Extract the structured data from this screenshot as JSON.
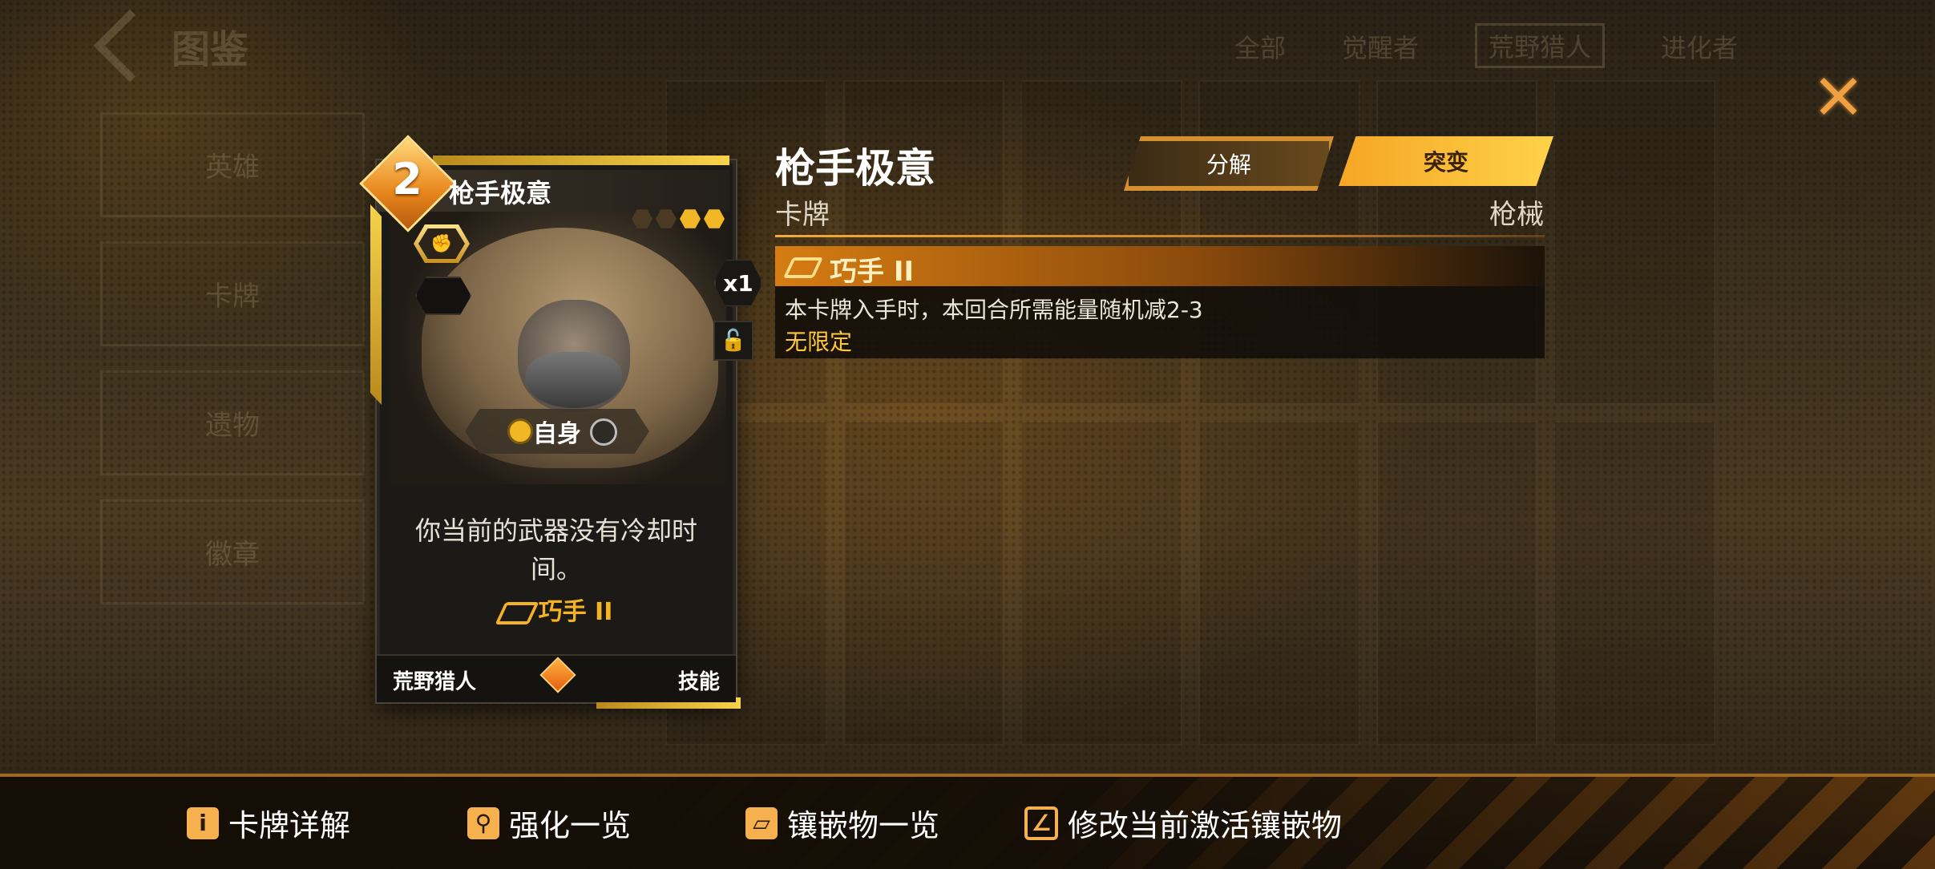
{
  "background": {
    "title": "图鉴",
    "tabs": [
      "全部",
      "觉醒者",
      "荒野猎人",
      "进化者"
    ],
    "side_items": [
      "英雄",
      "卡牌",
      "遗物",
      "徽章"
    ]
  },
  "card": {
    "cost": "2",
    "name": "枪手极意",
    "count": "x1",
    "target": "自身",
    "description": "你当前的武器没有冷却时间。",
    "keyword": "巧手 II",
    "class": "荒野猎人",
    "category": "技能",
    "type_icon": "fist-icon",
    "lock_icon": "unlock-icon"
  },
  "info": {
    "title": "枪手极意",
    "type": "卡牌",
    "tag": "枪械",
    "buttons": {
      "decompose": "分解",
      "mutate": "突变"
    },
    "keyword_name": "巧手 II",
    "keyword_desc": "本卡牌入手时，本回合所需能量随机减2-3",
    "keyword_limit": "无限定"
  },
  "bottom_bar": {
    "items": [
      {
        "label": "卡牌详解",
        "icon": "info-icon"
      },
      {
        "label": "强化一览",
        "icon": "search-icon"
      },
      {
        "label": "镶嵌物一览",
        "icon": "inlay-icon"
      },
      {
        "label": "修改当前激活镶嵌物",
        "icon": "edit-icon"
      }
    ]
  },
  "colors": {
    "accent": "#f5a624",
    "gold": "#f7d34a",
    "keyword": "#ffc83a"
  }
}
